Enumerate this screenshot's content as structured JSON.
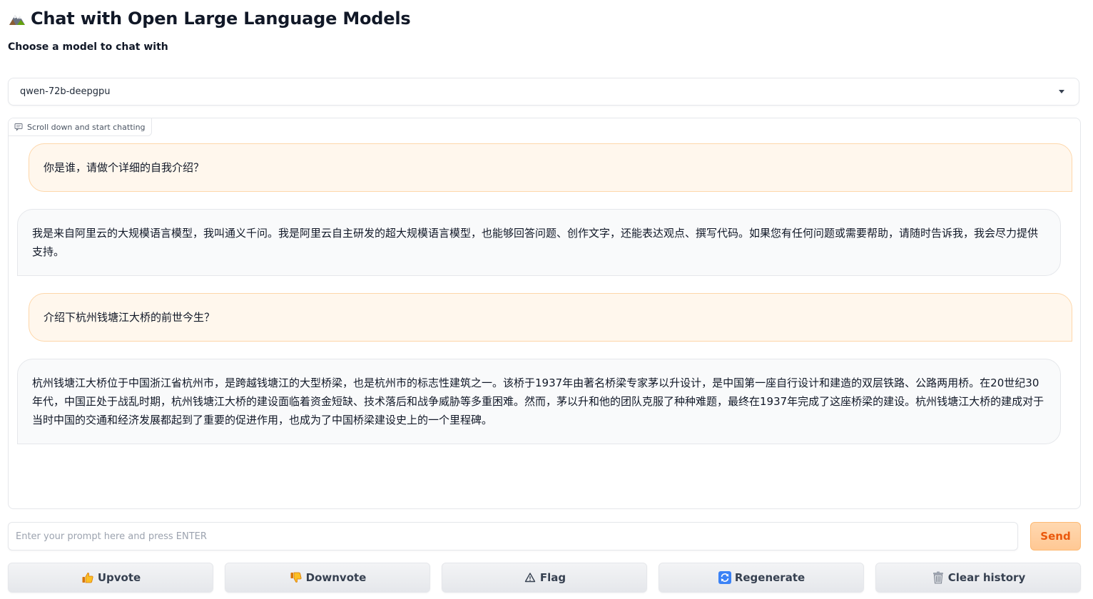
{
  "header": {
    "title": "Chat with Open Large Language Models",
    "subtitle": "Choose a model to chat with"
  },
  "model_select": {
    "selected": "qwen-72b-deepgpu"
  },
  "chatbot": {
    "label": "Scroll down and start chatting",
    "messages": [
      {
        "role": "user",
        "text": "你是谁，请做个详细的自我介绍？"
      },
      {
        "role": "bot",
        "text": "我是来自阿里云的大规模语言模型，我叫通义千问。我是阿里云自主研发的超大规模语言模型，也能够回答问题、创作文字，还能表达观点、撰写代码。如果您有任何问题或需要帮助，请随时告诉我，我会尽力提供支持。"
      },
      {
        "role": "user",
        "text": "介绍下杭州钱塘江大桥的前世今生？"
      },
      {
        "role": "bot",
        "text": "杭州钱塘江大桥位于中国浙江省杭州市，是跨越钱塘江的大型桥梁，也是杭州市的标志性建筑之一。该桥于1937年由著名桥梁专家茅以升设计，是中国第一座自行设计和建造的双层铁路、公路两用桥。在20世纪30年代，中国正处于战乱时期，杭州钱塘江大桥的建设面临着资金短缺、技术落后和战争威胁等多重困难。然而，茅以升和他的团队克服了种种难题，最终在1937年完成了这座桥梁的建设。杭州钱塘江大桥的建成对于当时中国的交通和经济发展都起到了重要的促进作用，也成为了中国桥梁建设史上的一个里程碑。"
      }
    ]
  },
  "input": {
    "placeholder": "Enter your prompt here and press ENTER",
    "value": ""
  },
  "send_label": "Send",
  "buttons": {
    "upvote": "Upvote",
    "downvote": "Downvote",
    "flag": "Flag",
    "regenerate": "Regenerate",
    "clear": "Clear history"
  },
  "colors": {
    "accent": "#ea580c",
    "user_bubble": "#fff7ed",
    "bot_bubble": "#f9fafb"
  }
}
